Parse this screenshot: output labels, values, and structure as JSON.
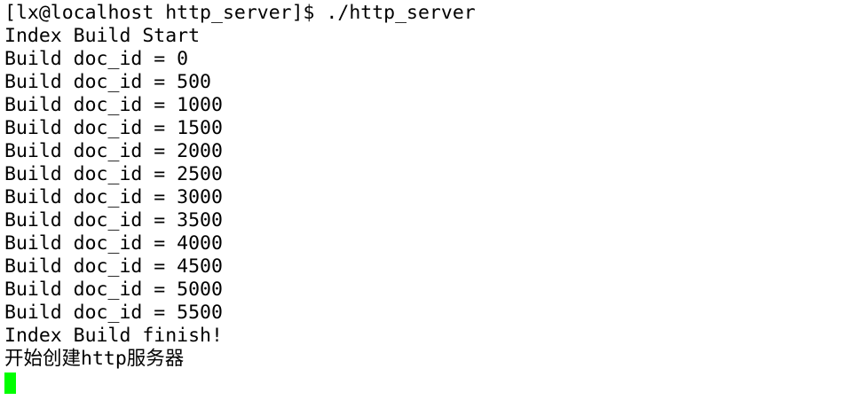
{
  "terminal": {
    "lines": [
      "[lx@localhost http_server]$ ./http_server",
      "Index Build Start",
      "Build doc_id = 0",
      "Build doc_id = 500",
      "Build doc_id = 1000",
      "Build doc_id = 1500",
      "Build doc_id = 2000",
      "Build doc_id = 2500",
      "Build doc_id = 3000",
      "Build doc_id = 3500",
      "Build doc_id = 4000",
      "Build doc_id = 4500",
      "Build doc_id = 5000",
      "Build doc_id = 5500",
      "Index Build finish!",
      "开始创建http服务器"
    ],
    "cursor_color": "#00ff00",
    "text_color": "#000000",
    "background_color": "#ffffff"
  }
}
